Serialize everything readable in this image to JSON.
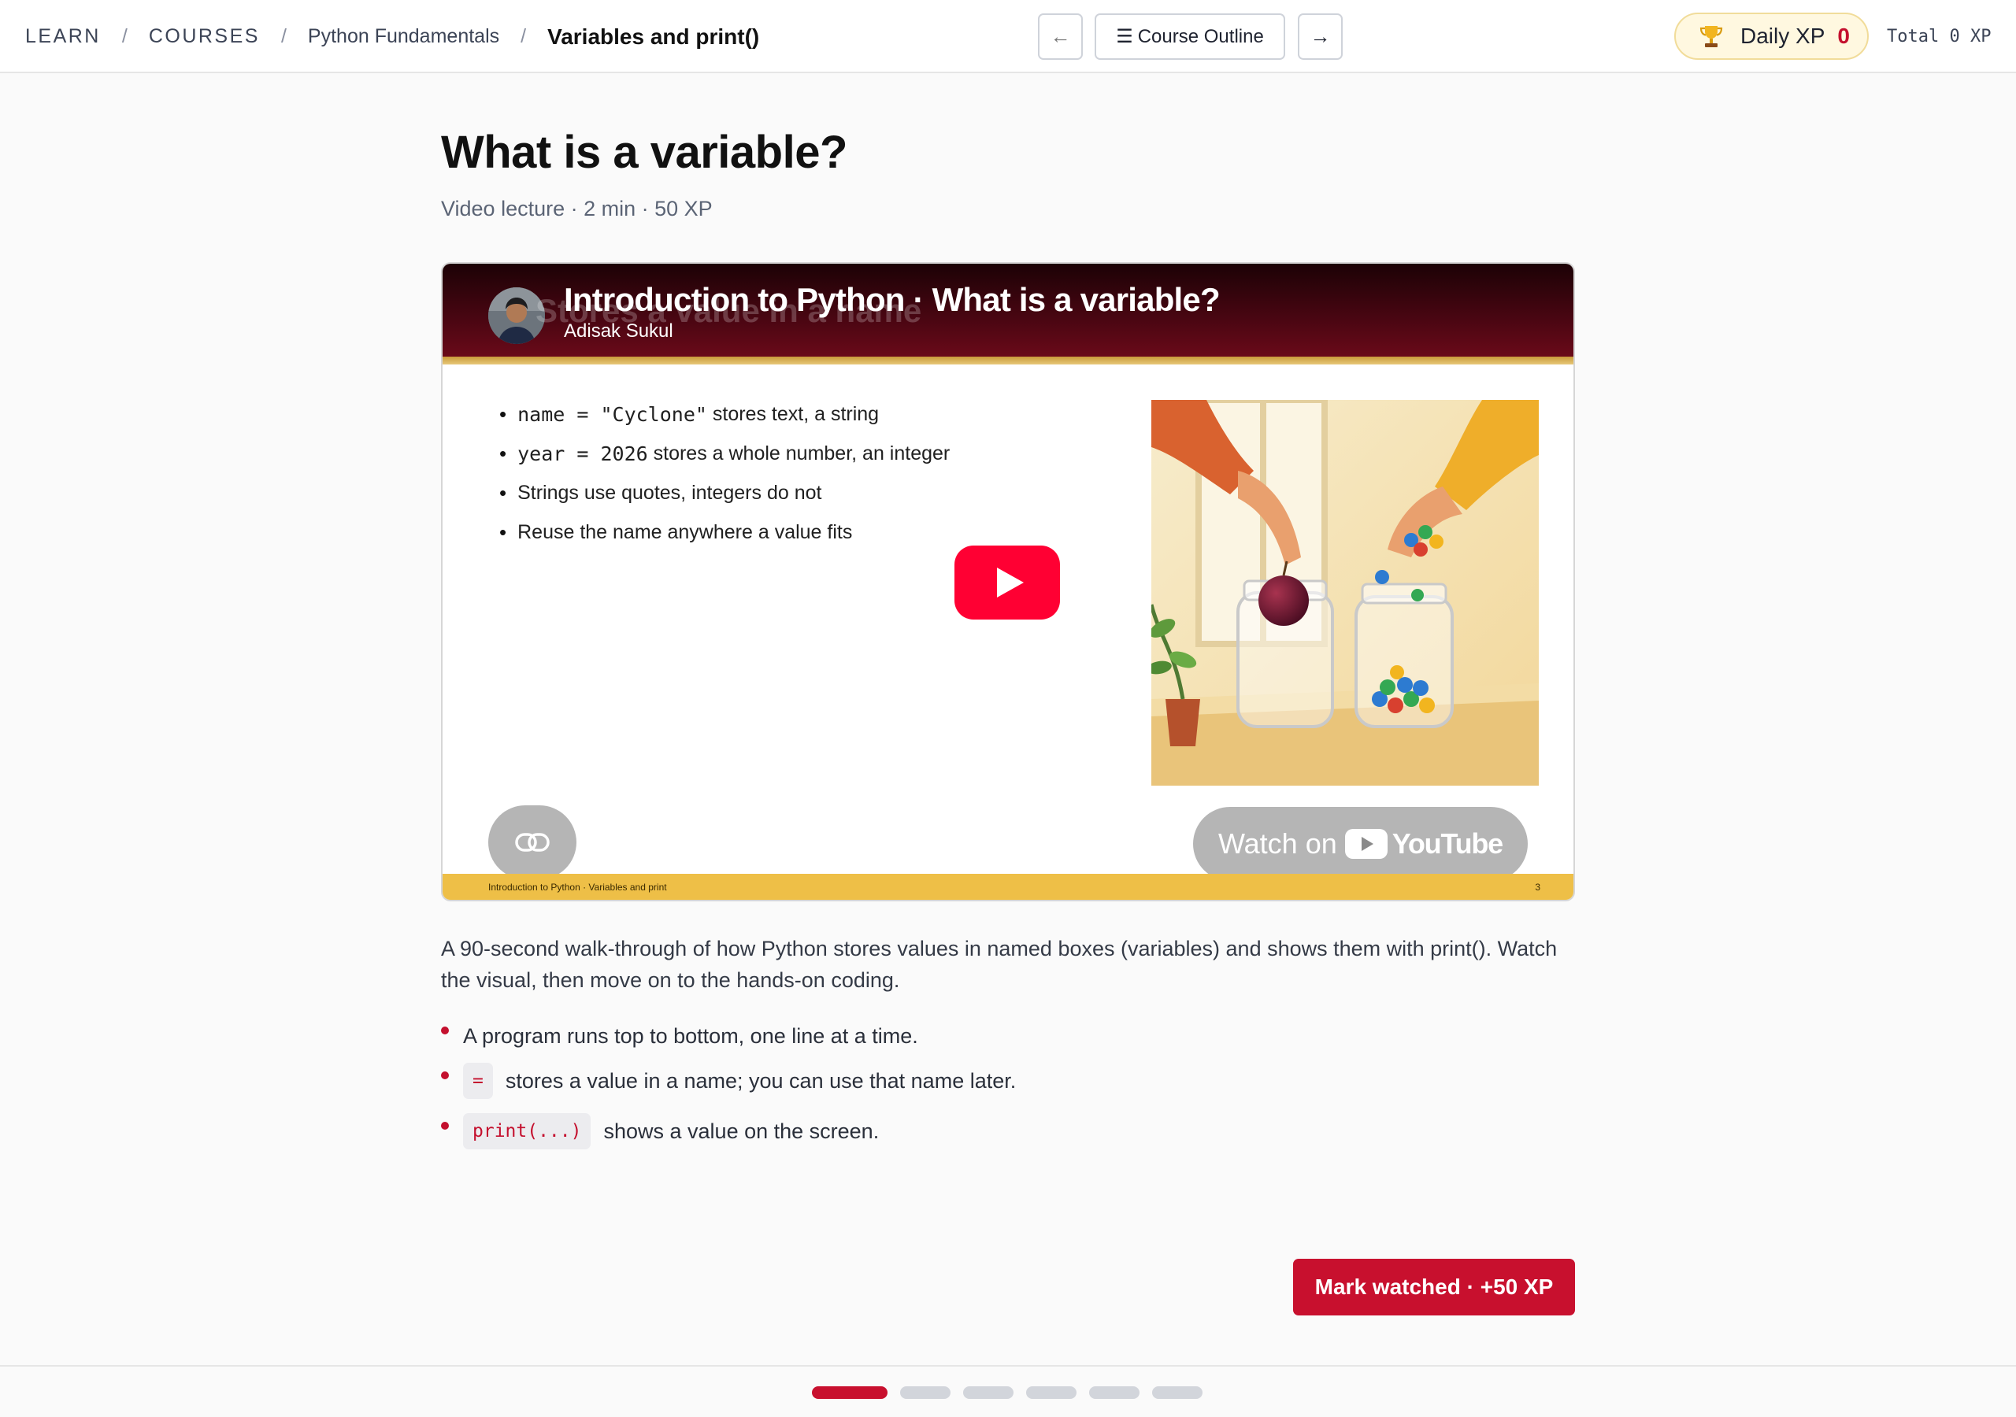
{
  "breadcrumb": {
    "items": [
      "LEARN",
      "COURSES",
      "Python Fundamentals"
    ],
    "current": "Variables and print()",
    "separator": "/"
  },
  "nav": {
    "prev_symbol": "←",
    "next_symbol": "→",
    "outline_glyph": "☰",
    "outline_label": "Course Outline"
  },
  "xp": {
    "daily_label": "Daily XP",
    "daily_value": "0",
    "total_label": "Total 0 XP"
  },
  "lesson": {
    "title": "What is a variable?",
    "meta": "Video lecture · 2 min · 50 XP"
  },
  "video": {
    "title": "Introduction to Python · What is a variable?",
    "ghost_text": "Stores a value in a name",
    "author": "Adisak Sukul",
    "bullets": [
      {
        "code": "name = \"Cyclone\"",
        "text": " stores text, a string"
      },
      {
        "code": "year = 2026",
        "text": " stores a whole number, an integer"
      },
      {
        "code": "",
        "text": "Strings use quotes, integers do not"
      },
      {
        "code": "",
        "text": "Reuse the name anywhere a value fits"
      }
    ],
    "watch_on": "Watch on",
    "youtube_word": "YouTube",
    "footer_text": "Introduction to Python · Variables and print",
    "footer_page": "3"
  },
  "description": "A 90-second walk-through of how Python stores values in named boxes (variables) and shows them with print(). Watch the visual, then move on to the hands-on coding.",
  "points": [
    {
      "code": "",
      "text": "A program runs top to bottom, one line at a time."
    },
    {
      "code": "=",
      "text": "stores a value in a name; you can use that name later."
    },
    {
      "code": "print(...)",
      "text": "shows a value on the screen."
    }
  ],
  "actions": {
    "mark_watched": "Mark watched · +50 XP"
  },
  "progress": {
    "total_steps": 6,
    "current_step": 1
  },
  "colors": {
    "accent": "#c8102e",
    "header_dark": "#4a0612",
    "footer_gold": "#eebf47",
    "xp_pill_bg": "#fff8e0"
  }
}
